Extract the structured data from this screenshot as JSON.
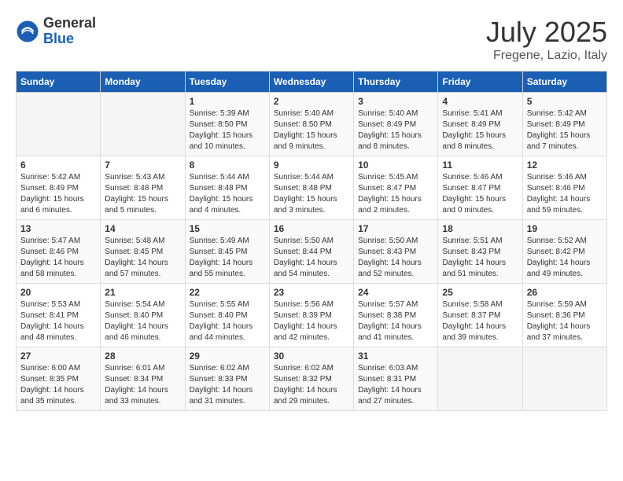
{
  "logo": {
    "general": "General",
    "blue": "Blue"
  },
  "title": "July 2025",
  "location": "Fregene, Lazio, Italy",
  "days_of_week": [
    "Sunday",
    "Monday",
    "Tuesday",
    "Wednesday",
    "Thursday",
    "Friday",
    "Saturday"
  ],
  "weeks": [
    [
      {
        "day": "",
        "info": ""
      },
      {
        "day": "",
        "info": ""
      },
      {
        "day": "1",
        "info": "Sunrise: 5:39 AM\nSunset: 8:50 PM\nDaylight: 15 hours and 10 minutes."
      },
      {
        "day": "2",
        "info": "Sunrise: 5:40 AM\nSunset: 8:50 PM\nDaylight: 15 hours and 9 minutes."
      },
      {
        "day": "3",
        "info": "Sunrise: 5:40 AM\nSunset: 8:49 PM\nDaylight: 15 hours and 8 minutes."
      },
      {
        "day": "4",
        "info": "Sunrise: 5:41 AM\nSunset: 8:49 PM\nDaylight: 15 hours and 8 minutes."
      },
      {
        "day": "5",
        "info": "Sunrise: 5:42 AM\nSunset: 8:49 PM\nDaylight: 15 hours and 7 minutes."
      }
    ],
    [
      {
        "day": "6",
        "info": "Sunrise: 5:42 AM\nSunset: 8:49 PM\nDaylight: 15 hours and 6 minutes."
      },
      {
        "day": "7",
        "info": "Sunrise: 5:43 AM\nSunset: 8:48 PM\nDaylight: 15 hours and 5 minutes."
      },
      {
        "day": "8",
        "info": "Sunrise: 5:44 AM\nSunset: 8:48 PM\nDaylight: 15 hours and 4 minutes."
      },
      {
        "day": "9",
        "info": "Sunrise: 5:44 AM\nSunset: 8:48 PM\nDaylight: 15 hours and 3 minutes."
      },
      {
        "day": "10",
        "info": "Sunrise: 5:45 AM\nSunset: 8:47 PM\nDaylight: 15 hours and 2 minutes."
      },
      {
        "day": "11",
        "info": "Sunrise: 5:46 AM\nSunset: 8:47 PM\nDaylight: 15 hours and 0 minutes."
      },
      {
        "day": "12",
        "info": "Sunrise: 5:46 AM\nSunset: 8:46 PM\nDaylight: 14 hours and 59 minutes."
      }
    ],
    [
      {
        "day": "13",
        "info": "Sunrise: 5:47 AM\nSunset: 8:46 PM\nDaylight: 14 hours and 58 minutes."
      },
      {
        "day": "14",
        "info": "Sunrise: 5:48 AM\nSunset: 8:45 PM\nDaylight: 14 hours and 57 minutes."
      },
      {
        "day": "15",
        "info": "Sunrise: 5:49 AM\nSunset: 8:45 PM\nDaylight: 14 hours and 55 minutes."
      },
      {
        "day": "16",
        "info": "Sunrise: 5:50 AM\nSunset: 8:44 PM\nDaylight: 14 hours and 54 minutes."
      },
      {
        "day": "17",
        "info": "Sunrise: 5:50 AM\nSunset: 8:43 PM\nDaylight: 14 hours and 52 minutes."
      },
      {
        "day": "18",
        "info": "Sunrise: 5:51 AM\nSunset: 8:43 PM\nDaylight: 14 hours and 51 minutes."
      },
      {
        "day": "19",
        "info": "Sunrise: 5:52 AM\nSunset: 8:42 PM\nDaylight: 14 hours and 49 minutes."
      }
    ],
    [
      {
        "day": "20",
        "info": "Sunrise: 5:53 AM\nSunset: 8:41 PM\nDaylight: 14 hours and 48 minutes."
      },
      {
        "day": "21",
        "info": "Sunrise: 5:54 AM\nSunset: 8:40 PM\nDaylight: 14 hours and 46 minutes."
      },
      {
        "day": "22",
        "info": "Sunrise: 5:55 AM\nSunset: 8:40 PM\nDaylight: 14 hours and 44 minutes."
      },
      {
        "day": "23",
        "info": "Sunrise: 5:56 AM\nSunset: 8:39 PM\nDaylight: 14 hours and 42 minutes."
      },
      {
        "day": "24",
        "info": "Sunrise: 5:57 AM\nSunset: 8:38 PM\nDaylight: 14 hours and 41 minutes."
      },
      {
        "day": "25",
        "info": "Sunrise: 5:58 AM\nSunset: 8:37 PM\nDaylight: 14 hours and 39 minutes."
      },
      {
        "day": "26",
        "info": "Sunrise: 5:59 AM\nSunset: 8:36 PM\nDaylight: 14 hours and 37 minutes."
      }
    ],
    [
      {
        "day": "27",
        "info": "Sunrise: 6:00 AM\nSunset: 8:35 PM\nDaylight: 14 hours and 35 minutes."
      },
      {
        "day": "28",
        "info": "Sunrise: 6:01 AM\nSunset: 8:34 PM\nDaylight: 14 hours and 33 minutes."
      },
      {
        "day": "29",
        "info": "Sunrise: 6:02 AM\nSunset: 8:33 PM\nDaylight: 14 hours and 31 minutes."
      },
      {
        "day": "30",
        "info": "Sunrise: 6:02 AM\nSunset: 8:32 PM\nDaylight: 14 hours and 29 minutes."
      },
      {
        "day": "31",
        "info": "Sunrise: 6:03 AM\nSunset: 8:31 PM\nDaylight: 14 hours and 27 minutes."
      },
      {
        "day": "",
        "info": ""
      },
      {
        "day": "",
        "info": ""
      }
    ]
  ]
}
